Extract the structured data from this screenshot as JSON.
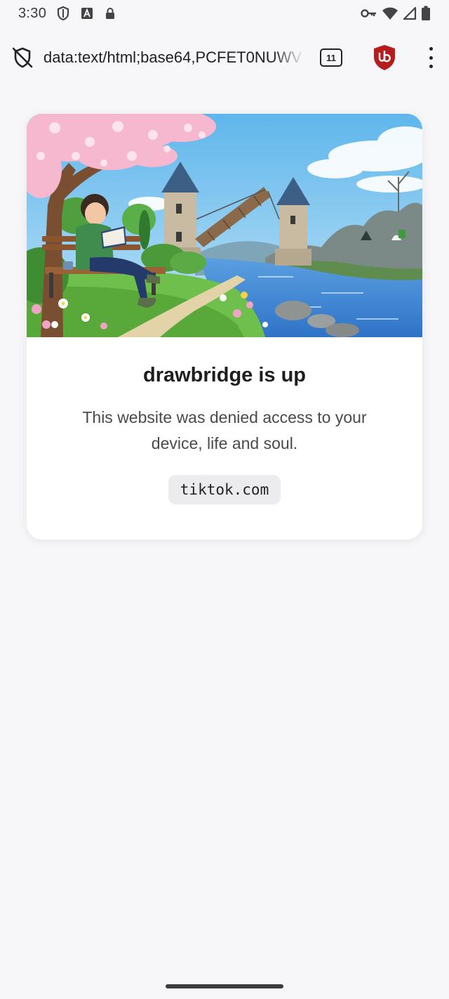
{
  "status_bar": {
    "time": "3:30",
    "icons": [
      "shield-outline-icon",
      "font-a-icon",
      "lock-icon",
      "vpn-key-icon",
      "wifi-icon",
      "signal-icon",
      "battery-icon"
    ]
  },
  "toolbar": {
    "url": "data:text/html;base64,PCFET0NUWV",
    "tab_count": "11",
    "icons": [
      "tracking-protection-off-icon",
      "ublock-origin-icon",
      "overflow-menu-icon"
    ]
  },
  "card": {
    "title": "drawbridge is up",
    "description": "This website was denied access to your device, life and soul.",
    "domain": "tiktok.com",
    "illustration": "boy reading on a bench under a cherry blossom tree beside a river with a raised drawbridge between two towers"
  },
  "colors": {
    "page_background": "#f7f7fa",
    "card_background": "#ffffff",
    "chip_background": "#ececef",
    "ublock_red": "#b71c1c"
  }
}
